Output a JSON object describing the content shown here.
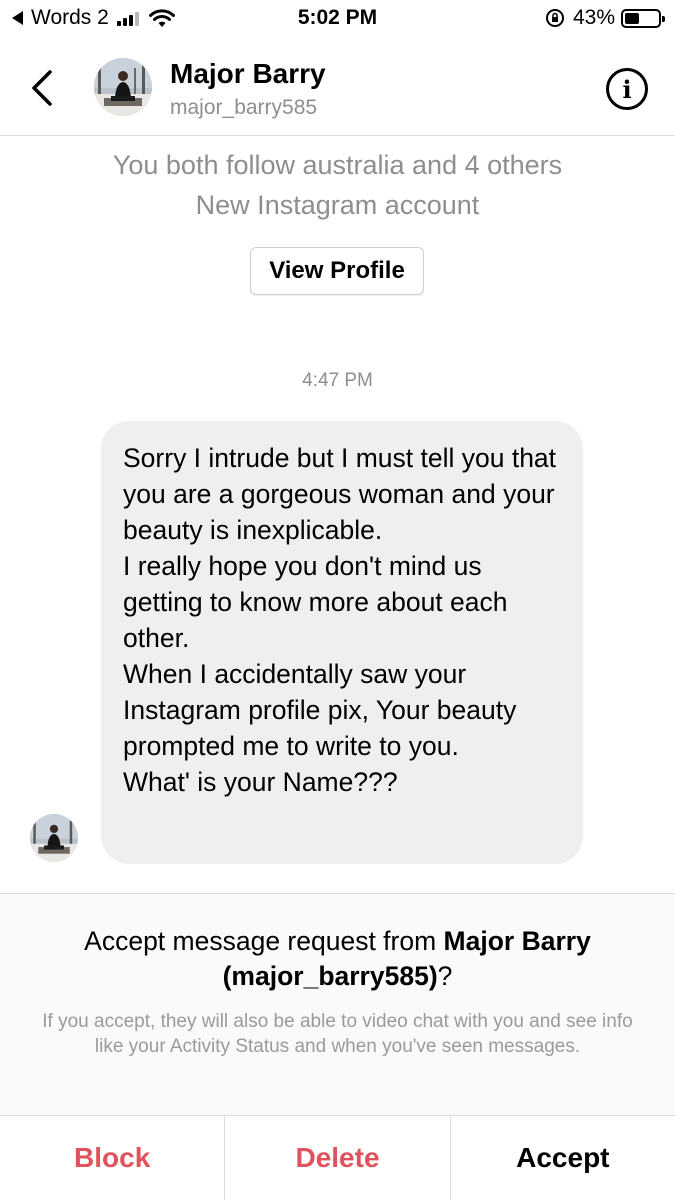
{
  "status_bar": {
    "back_app": "Words 2",
    "time": "5:02 PM",
    "battery_percent": "43%",
    "battery_level": 0.43,
    "signal_bars_active": 3,
    "signal_bars_total": 4
  },
  "header": {
    "name": "Major Barry",
    "username": "major_barry585",
    "info_icon": "info-circle-icon",
    "back_icon": "chevron-left-icon"
  },
  "profile_context": {
    "mutual_follow": "You both follow australia and 4 others",
    "account_note": "New Instagram account",
    "view_profile_label": "View Profile"
  },
  "thread": {
    "timestamp": "4:47 PM",
    "message": {
      "paragraphs": [
        "Sorry I intrude but I must tell you that you are a gorgeous woman and your beauty is inexplicable.",
        "I really hope you don't mind us getting to know more about each other.",
        "When I accidentally saw your Instagram profile pix, Your beauty prompted me to write to you.",
        "What' is your Name???"
      ]
    }
  },
  "request": {
    "title_prefix": "Accept message request from ",
    "title_name": "Major Barry",
    "title_username": "(major_barry585)",
    "title_suffix": "?",
    "description": "If you accept, they will also be able to video chat with you and see info like your Activity Status and when you've seen messages."
  },
  "actions": {
    "block_label": "Block",
    "delete_label": "Delete",
    "accept_label": "Accept"
  },
  "colors": {
    "danger": "#e0525c",
    "bubble": "#efefef",
    "muted_text": "#8e8e8e"
  }
}
